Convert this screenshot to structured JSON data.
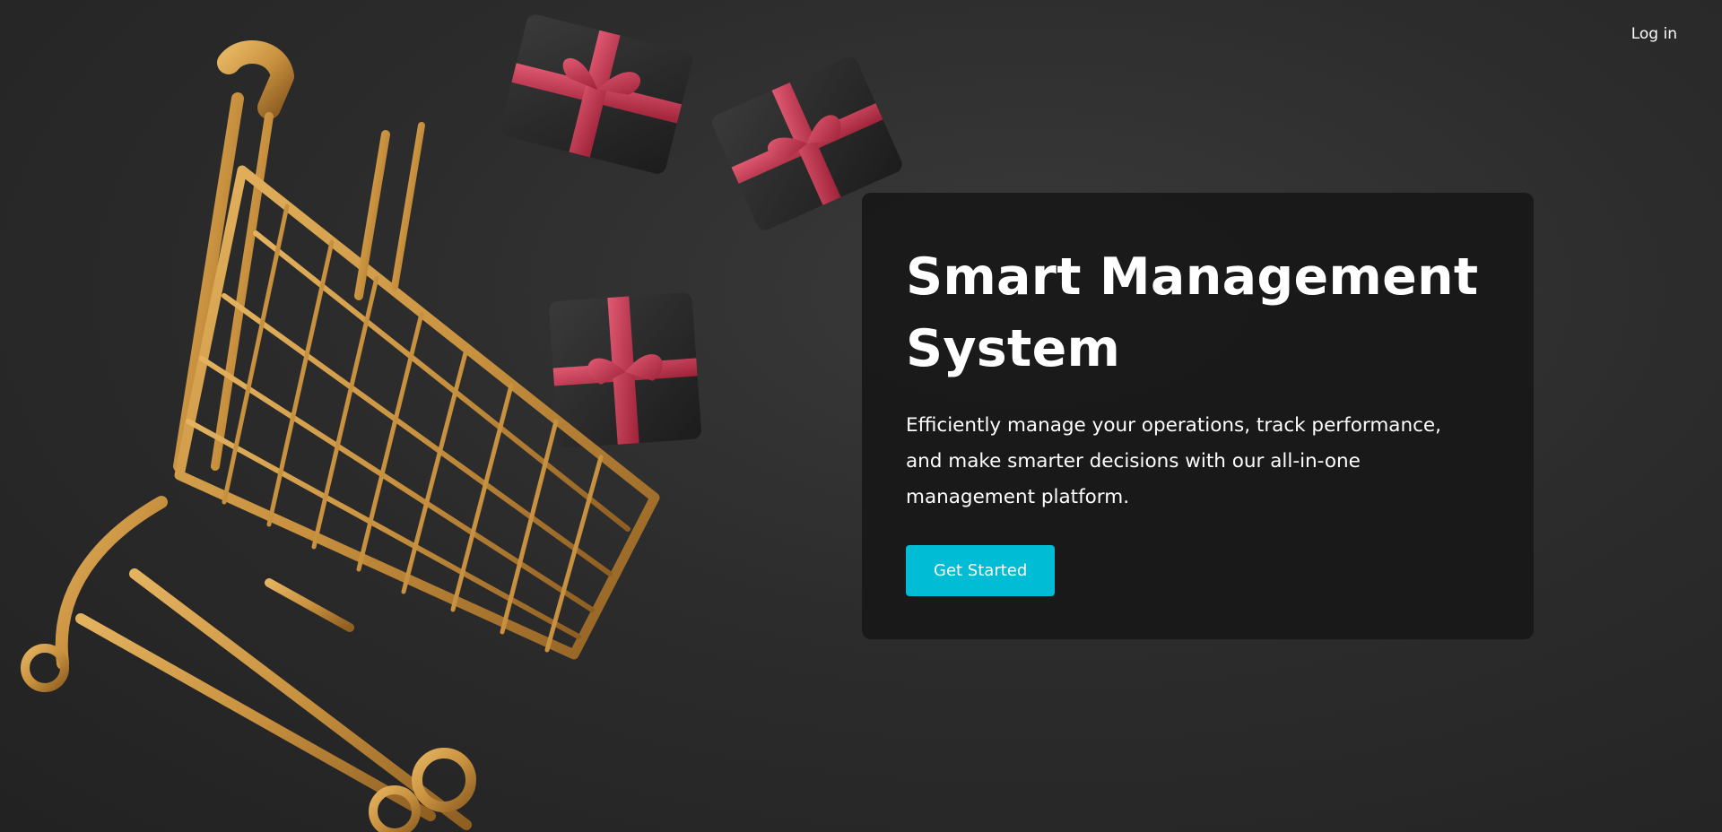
{
  "nav": {
    "login_label": "Log in"
  },
  "hero": {
    "title": "Smart Management System",
    "description": "Efficiently manage your operations, track performance, and make smarter decisions with our all-in-one management platform.",
    "cta_label": "Get Started"
  },
  "colors": {
    "background": "#2a2a2a",
    "card_background": "#181818",
    "accent": "#00bcd4",
    "cart_gold": "#c8913f",
    "gift_box": "#2b2b2b",
    "ribbon": "#c2374f"
  },
  "illustration": {
    "icons": [
      "shopping-cart-icon",
      "gift-box-icon"
    ]
  }
}
